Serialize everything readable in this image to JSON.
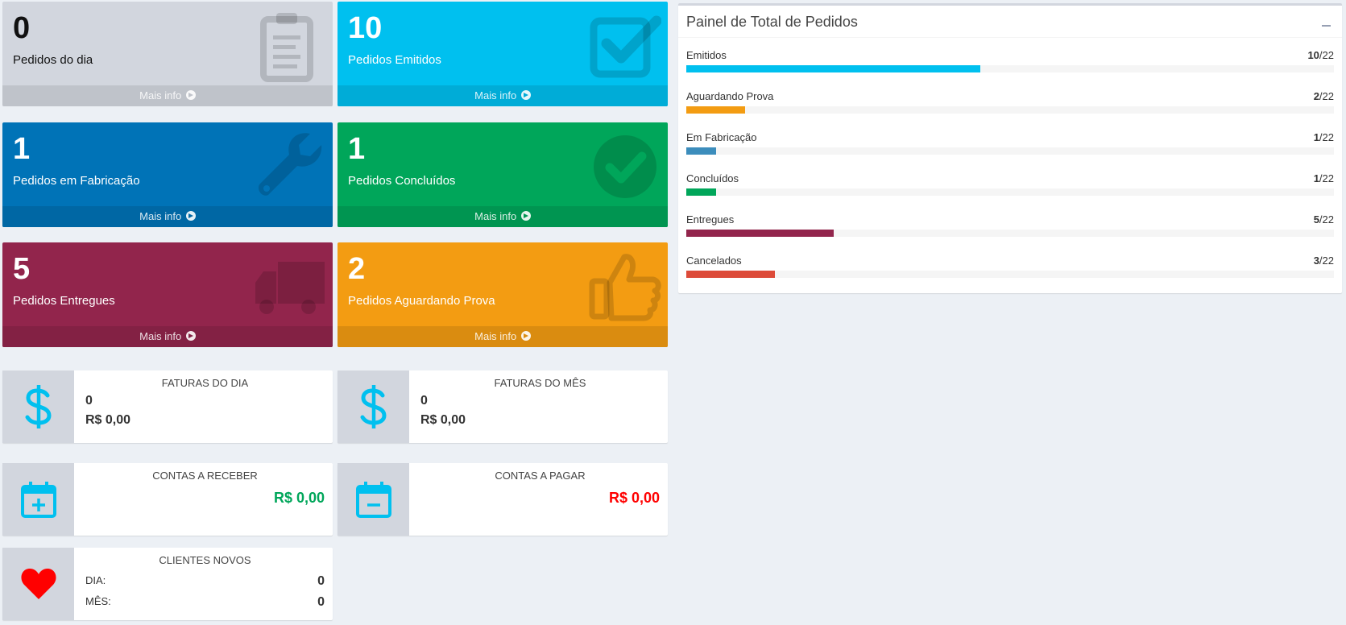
{
  "small_boxes": [
    {
      "value": "0",
      "label": "Pedidos do dia",
      "footer": "Mais info",
      "bg": "#d2d6de",
      "footer_bg": "#bfc3ca",
      "text": "#111111",
      "icon": "clipboard-icon"
    },
    {
      "value": "10",
      "label": "Pedidos Emitidos",
      "footer": "Mais info",
      "bg": "#00c0ef",
      "footer_bg": "#00acd7",
      "text": "#ffffff",
      "icon": "checkbox-icon"
    },
    {
      "value": "1",
      "label": "Pedidos em Fabricação",
      "footer": "Mais info",
      "bg": "#0073b7",
      "footer_bg": "#0067a4",
      "text": "#ffffff",
      "icon": "wrench-icon"
    },
    {
      "value": "1",
      "label": "Pedidos Concluídos",
      "footer": "Mais info",
      "bg": "#00a65a",
      "footer_bg": "#009551",
      "text": "#ffffff",
      "icon": "check-circle-icon"
    },
    {
      "value": "5",
      "label": "Pedidos Entregues",
      "footer": "Mais info",
      "bg": "#92254c",
      "footer_bg": "#832144",
      "text": "#ffffff",
      "icon": "truck-icon"
    },
    {
      "value": "2",
      "label": "Pedidos Aguardando Prova",
      "footer": "Mais info",
      "bg": "#f39c12",
      "footer_bg": "#da8c10",
      "text": "#ffffff",
      "icon": "thumbs-up-icon"
    }
  ],
  "faturas_dia": {
    "title": "FATURAS DO DIA",
    "count": "0",
    "amount": "R$ 0,00"
  },
  "faturas_mes": {
    "title": "FATURAS DO MÊS",
    "count": "0",
    "amount": "R$ 0,00"
  },
  "contas_receber": {
    "title": "CONTAS A RECEBER",
    "amount": "R$ 0,00",
    "color": "#00a65a"
  },
  "contas_pagar": {
    "title": "CONTAS A PAGAR",
    "amount": "R$ 0,00",
    "color": "#ff0000"
  },
  "clientes_novos": {
    "title": "CLIENTES NOVOS",
    "dia_label": "DIA:",
    "dia_value": "0",
    "mes_label": "MÊS:",
    "mes_value": "0"
  },
  "panel": {
    "title": "Painel de Total de Pedidos",
    "total_suffix": "/22",
    "items": [
      {
        "label": "Emitidos",
        "count": "10",
        "fraction": 0.4545,
        "color": "#00c0ef"
      },
      {
        "label": "Aguardando Prova",
        "count": "2",
        "fraction": 0.0909,
        "color": "#f39c12"
      },
      {
        "label": "Em Fabricação",
        "count": "1",
        "fraction": 0.0455,
        "color": "#3c8dbc"
      },
      {
        "label": "Concluídos",
        "count": "1",
        "fraction": 0.0455,
        "color": "#00a65a"
      },
      {
        "label": "Entregues",
        "count": "5",
        "fraction": 0.2273,
        "color": "#92254c"
      },
      {
        "label": "Cancelados",
        "count": "3",
        "fraction": 0.1364,
        "color": "#dd4b39"
      }
    ]
  },
  "icon_colors": {
    "dollar": "#00c0ef",
    "calendar": "#00c0ef",
    "heart": "#ff0000"
  }
}
